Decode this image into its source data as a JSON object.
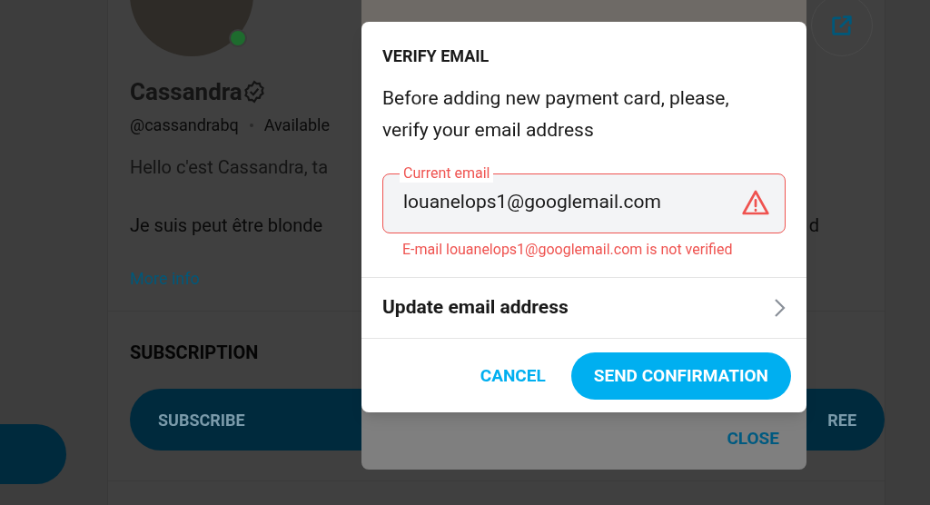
{
  "profile": {
    "name": "Cassandra",
    "verified": true,
    "online": true,
    "handle": "@cassandrabq",
    "availability": "Available",
    "bio_lines": [
      "Hello c'est Cassandra, ta",
      "Je suis peut être blonde"
    ],
    "bio_right_fragment": "d",
    "more_info": "More info"
  },
  "subscription": {
    "heading": "SUBSCRIPTION",
    "subscribe_button": "SUBSCRIBE",
    "free_button": "REE"
  },
  "background_dialog": {
    "close_button": "CLOSE"
  },
  "modal": {
    "title": "VERIFY EMAIL",
    "message": "Before adding new payment card, please, verify your email address",
    "email_field": {
      "label": "Current email",
      "value": "louanelops1@googlemail.com",
      "error": true
    },
    "error_text": "E-mail louanelops1@googlemail.com is not verified",
    "update_row": "Update email address",
    "buttons": [
      {
        "label": "CANCEL",
        "kind": "text"
      },
      {
        "label": "SEND CONFIRMATION",
        "kind": "primary"
      }
    ]
  }
}
